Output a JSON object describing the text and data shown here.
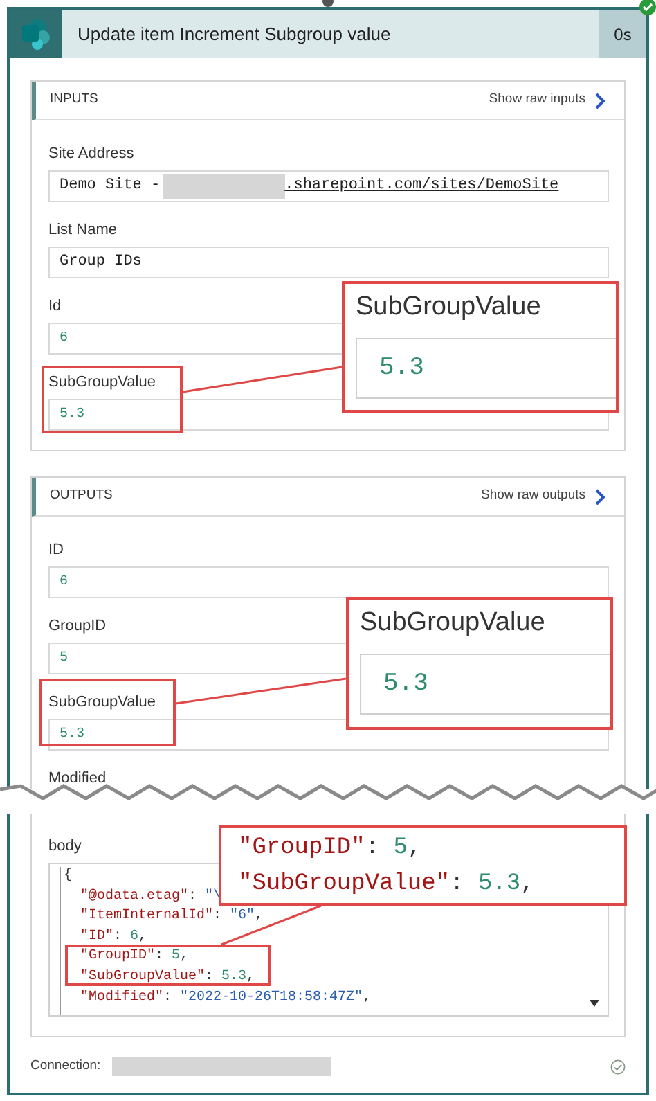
{
  "header": {
    "title": "Update item Increment Subgroup value",
    "duration": "0s",
    "succeeded": true
  },
  "inputs": {
    "title": "INPUTS",
    "raw_link": "Show raw inputs",
    "fields": [
      {
        "label": "Site Address",
        "kind": "site",
        "prefix": "Demo Site -",
        "suffix": ".sharepoint.com/sites/DemoSite"
      },
      {
        "label": "List Name",
        "kind": "text",
        "value": "Group IDs"
      },
      {
        "label": "Id",
        "kind": "number",
        "value": "6"
      },
      {
        "label": "SubGroupValue",
        "kind": "number",
        "value": "5.3"
      }
    ]
  },
  "outputs": {
    "title": "OUTPUTS",
    "raw_link": "Show raw outputs",
    "fields": [
      {
        "label": "ID",
        "kind": "number",
        "value": "6"
      },
      {
        "label": "GroupID",
        "kind": "number",
        "value": "5"
      },
      {
        "label": "SubGroupValue",
        "kind": "number",
        "value": "5.3"
      },
      {
        "label": "Modified",
        "kind": "torn"
      }
    ],
    "body": {
      "label": "body",
      "open": "{",
      "members": [
        [
          {
            "t": "\"@odata.etag\"",
            "kind": "key"
          },
          {
            "t": ": ",
            "kind": "punct"
          },
          {
            "t": "\"\\",
            "kind": "string"
          }
        ],
        [
          {
            "t": "\"ItemInternalId\"",
            "kind": "key"
          },
          {
            "t": ": ",
            "kind": "punct"
          },
          {
            "t": "\"6\"",
            "kind": "string"
          },
          {
            "t": ",",
            "kind": "punct"
          }
        ],
        [
          {
            "t": "\"ID\"",
            "kind": "key"
          },
          {
            "t": ": ",
            "kind": "punct"
          },
          {
            "t": "6",
            "kind": "number"
          },
          {
            "t": ",",
            "kind": "punct"
          }
        ],
        [
          {
            "t": "\"GroupID\"",
            "kind": "key"
          },
          {
            "t": ": ",
            "kind": "punct"
          },
          {
            "t": "5",
            "kind": "number"
          },
          {
            "t": ",",
            "kind": "punct"
          }
        ],
        [
          {
            "t": "\"SubGroupValue\"",
            "kind": "key"
          },
          {
            "t": ": ",
            "kind": "punct"
          },
          {
            "t": "5.3",
            "kind": "number"
          },
          {
            "t": ",",
            "kind": "punct"
          }
        ],
        [
          {
            "t": "\"Modified\"",
            "kind": "key"
          },
          {
            "t": ": ",
            "kind": "punct"
          },
          {
            "t": "\"2022-10-26T18:58:47Z\"",
            "kind": "string"
          },
          {
            "t": ",",
            "kind": "punct"
          }
        ]
      ]
    }
  },
  "connection": {
    "label": "Connection:"
  },
  "callouts": [
    {
      "kind": "field",
      "label": "SubGroupValue",
      "value": "5.3"
    },
    {
      "kind": "field",
      "label": "SubGroupValue",
      "value": "5.3"
    },
    {
      "kind": "code",
      "lines": [
        [
          {
            "t": "\"GroupID\"",
            "kind": "key"
          },
          {
            "t": ": ",
            "kind": "punct"
          },
          {
            "t": "5",
            "kind": "number"
          },
          {
            "t": ",",
            "kind": "punct"
          }
        ],
        [
          {
            "t": "\"SubGroupValue\"",
            "kind": "key"
          },
          {
            "t": ": ",
            "kind": "punct"
          },
          {
            "t": "5.3",
            "kind": "number"
          },
          {
            "t": ",",
            "kind": "punct"
          }
        ]
      ]
    }
  ]
}
